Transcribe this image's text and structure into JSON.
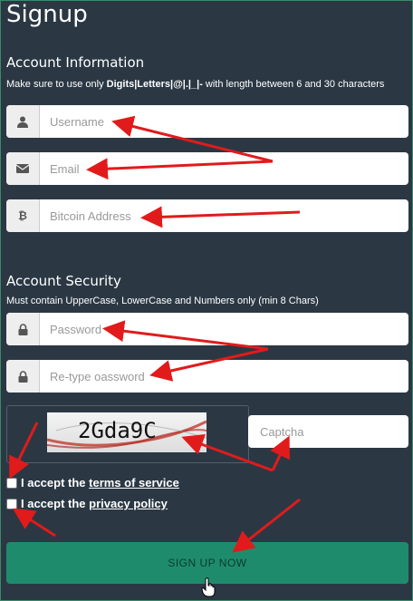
{
  "page": {
    "title": "Signup"
  },
  "account_info": {
    "heading": "Account Information",
    "hint_prefix": "Make sure to use only ",
    "hint_bold": "Digits|Letters|@|.|_|-",
    "hint_suffix": " with length between 6 and 30 characters",
    "fields": [
      {
        "placeholder": "Username",
        "icon": "user-icon"
      },
      {
        "placeholder": "Email",
        "icon": "envelope-icon"
      },
      {
        "placeholder": "Bitcoin Address",
        "icon": "bitcoin-icon"
      }
    ]
  },
  "account_security": {
    "heading": "Account Security",
    "hint": "Must contain UpperCase, LowerCase and Numbers only (min 8 Chars)",
    "fields": [
      {
        "placeholder": "Password",
        "icon": "lock-icon"
      },
      {
        "placeholder": "Re-type oassword",
        "icon": "lock-icon"
      }
    ]
  },
  "captcha": {
    "image_text": "2Gda9C",
    "placeholder": "Captcha"
  },
  "terms": {
    "prefix": "I accept the ",
    "link": "terms of service"
  },
  "privacy": {
    "prefix": "I accept the ",
    "link": "privacy policy"
  },
  "submit": {
    "label": "SIGN UP NOW"
  },
  "colors": {
    "background": "#2b3844",
    "button": "#1e8c6c",
    "arrow": "#e11b1b"
  }
}
